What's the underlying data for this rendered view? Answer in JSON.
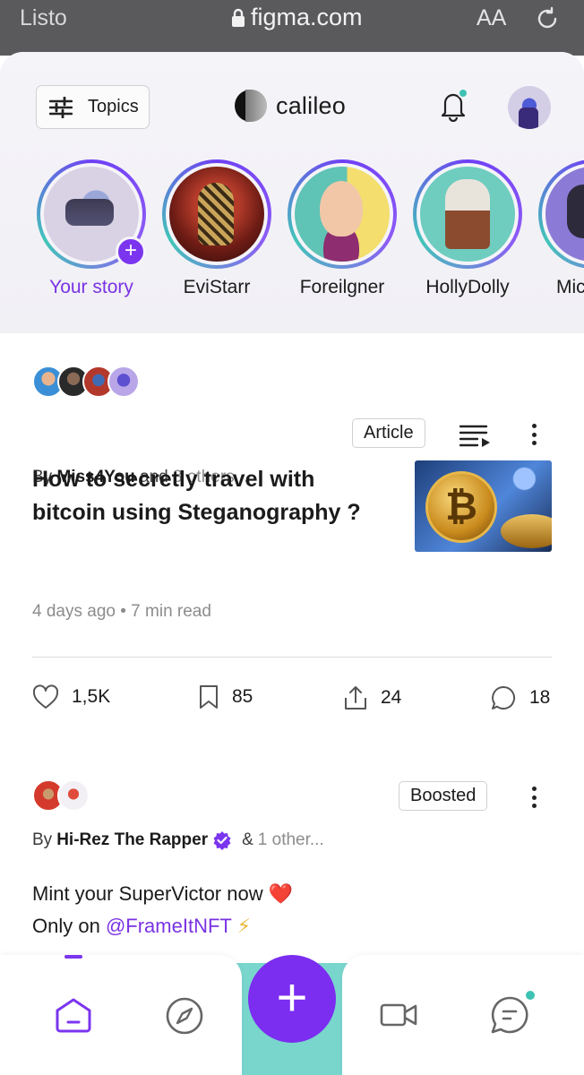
{
  "browser": {
    "left_text": "Listo",
    "url": "figma.com",
    "text_size_label": "AA"
  },
  "header": {
    "topics_label": "Topics",
    "logo_text": "calileo"
  },
  "stories": [
    {
      "name": "Your story",
      "is_self": true
    },
    {
      "name": "EviStarr",
      "is_self": false
    },
    {
      "name": "Foreilgner",
      "is_self": false
    },
    {
      "name": "HollyDolly",
      "is_self": false
    },
    {
      "name": "Mic",
      "is_self": false
    }
  ],
  "post1": {
    "tag": "Article",
    "by_prefix": "By",
    "author": "Miss4You",
    "and_text": "and",
    "others": "3 others...",
    "title": "How to secretly travel with bitcoin using Steganography ?",
    "meta": "4 days ago • 7 min read",
    "stats": {
      "likes": "1,5K",
      "saves": "85",
      "shares": "24",
      "comments": "18"
    }
  },
  "post2": {
    "tag": "Boosted",
    "by_prefix": "By",
    "author": "Hi-Rez The Rapper",
    "and_text": "&",
    "others": "1 other...",
    "line1": "Mint your SuperVictor now",
    "line1_emoji": "❤️",
    "line2_prefix": "Only on",
    "handle": "@FrameItNFT",
    "line2_emoji": "⚡"
  },
  "colors": {
    "accent": "#7b35ef",
    "teal": "#3ec2b3",
    "verified": "#7b35ef"
  },
  "icons": [
    "filter-sliders-icon",
    "bell-icon",
    "playlist-icon",
    "heart-icon",
    "bookmark-icon",
    "share-icon",
    "comment-icon",
    "home-icon",
    "compass-icon",
    "plus-icon",
    "video-icon",
    "chat-icon",
    "verified-badge-icon"
  ]
}
